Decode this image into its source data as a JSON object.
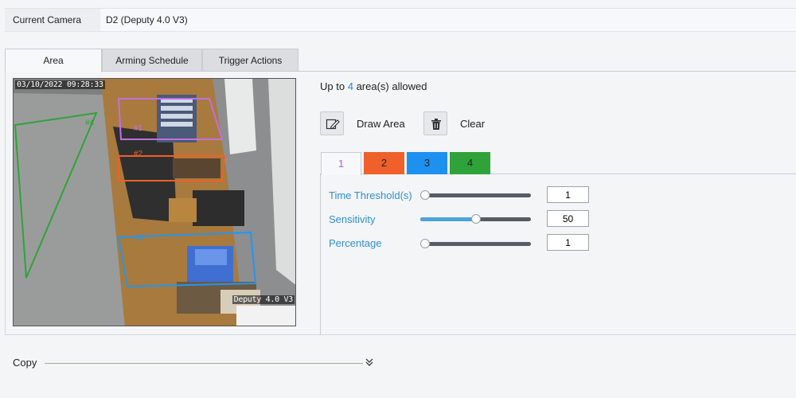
{
  "camera": {
    "label": "Current Camera",
    "value": "D2 (Deputy 4.0 V3)"
  },
  "tabs": [
    {
      "label": "Area",
      "active": true
    },
    {
      "label": "Arming Schedule",
      "active": false
    },
    {
      "label": "Trigger Actions",
      "active": false
    }
  ],
  "video": {
    "timestamp": "03/10/2022 09:28:33",
    "camera_name": "Deputy 4.0 V3",
    "regions": [
      {
        "label": "#1",
        "color": "#c070e0"
      },
      {
        "label": "#2",
        "color": "#f0602a"
      },
      {
        "label": "#3",
        "color": "#2196f3"
      },
      {
        "label": "#4",
        "color": "#2fa33a"
      }
    ]
  },
  "allowed": {
    "prefix": "Up to",
    "count": "4",
    "suffix": "area(s) allowed"
  },
  "tools": {
    "draw_label": "Draw Area",
    "clear_label": "Clear"
  },
  "area_tabs": [
    {
      "label": "1",
      "color": "#f7f8fa",
      "active": true
    },
    {
      "label": "2",
      "color": "#f0602a",
      "active": false
    },
    {
      "label": "3",
      "color": "#1e90f0",
      "active": false
    },
    {
      "label": "4",
      "color": "#2fa33a",
      "active": false
    }
  ],
  "params": [
    {
      "label": "Time Threshold(s)",
      "value": "1",
      "level": 0
    },
    {
      "label": "Sensitivity",
      "value": "50",
      "level": 0.5
    },
    {
      "label": "Percentage",
      "value": "1",
      "level": 0
    }
  ],
  "copy": {
    "label": "Copy"
  }
}
